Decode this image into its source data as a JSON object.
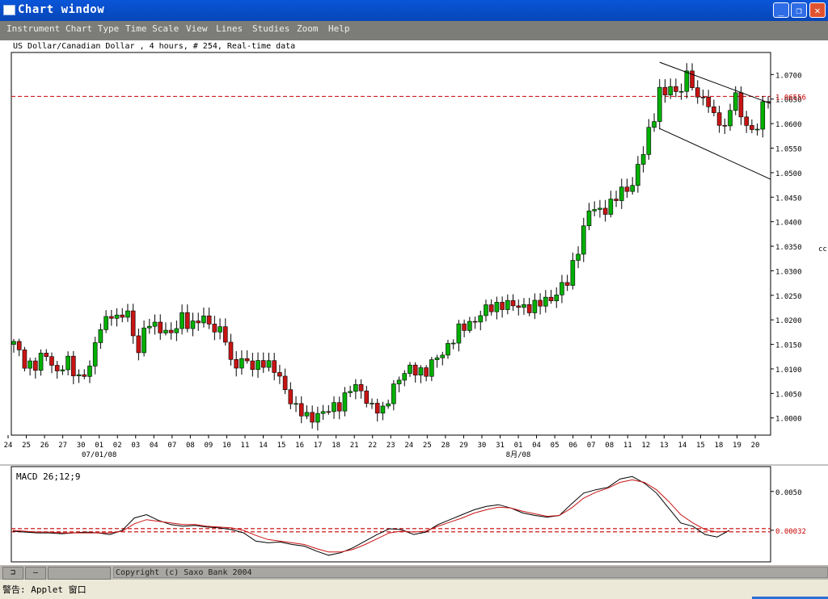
{
  "window": {
    "title": "Chart window",
    "icon": "app-window-icon",
    "btn_min": "_",
    "btn_max": "❐",
    "btn_close": "✕"
  },
  "menu": [
    "Instrument",
    "Chart Type",
    "Time Scale",
    "View",
    "Lines",
    "Studies",
    "Zoom",
    "Help"
  ],
  "chart_title": "US Dollar/Canadian Dollar , 4 hours, # 254, Real-time data",
  "side_label": "cc",
  "chart_data": [
    {
      "type": "candlestick",
      "y_ticks": [
        "1.0700",
        "1.0650",
        "1.0600",
        "1.0550",
        "1.0500",
        "1.0450",
        "1.0400",
        "1.0350",
        "1.0300",
        "1.0250",
        "1.0200",
        "1.0150",
        "1.0100",
        "1.0050",
        "1.0000"
      ],
      "ylim": [
        0.9965,
        1.0745
      ],
      "current_price_label": "1.06556",
      "current_price": 1.06556,
      "x_ticks": [
        "24",
        "25",
        "26",
        "27",
        "30",
        "01",
        "02",
        "03",
        "04",
        "07",
        "08",
        "09",
        "10",
        "11",
        "14",
        "15",
        "16",
        "17",
        "18",
        "21",
        "22",
        "23",
        "24",
        "25",
        "28",
        "29",
        "30",
        "31",
        "01",
        "04",
        "05",
        "06",
        "07",
        "08",
        "11",
        "12",
        "13",
        "14",
        "15",
        "18",
        "19",
        "20"
      ],
      "x_month_labels": [
        {
          "text": "07/01/08",
          "at_tick": 5
        },
        {
          "text": "8月/08",
          "at_tick": 28
        }
      ],
      "close_path": [
        [
          0,
          1.015
        ],
        [
          2,
          1.0115
        ],
        [
          4,
          1.0105
        ],
        [
          6,
          1.013
        ],
        [
          8,
          1.0095
        ],
        [
          10,
          1.011
        ],
        [
          12,
          1.0085
        ],
        [
          14,
          1.01
        ],
        [
          16,
          1.019
        ],
        [
          18,
          1.0215
        ],
        [
          19,
          1.0195
        ],
        [
          21,
          1.022
        ],
        [
          22,
          1.017
        ],
        [
          23,
          1.014
        ],
        [
          25,
          1.0195
        ],
        [
          27,
          1.0185
        ],
        [
          29,
          1.0165
        ],
        [
          31,
          1.021
        ],
        [
          33,
          1.0185
        ],
        [
          35,
          1.0205
        ],
        [
          37,
          1.0185
        ],
        [
          39,
          1.016
        ],
        [
          40,
          1.011
        ],
        [
          42,
          1.012
        ],
        [
          44,
          1.01
        ],
        [
          46,
          1.012
        ],
        [
          48,
          1.0095
        ],
        [
          50,
          1.006
        ],
        [
          52,
          1.002
        ],
        [
          54,
          0.9998
        ],
        [
          56,
          1.001
        ],
        [
          58,
          1.0012
        ],
        [
          60,
          1.003
        ],
        [
          62,
          1.006
        ],
        [
          64,
          1.0055
        ],
        [
          66,
          1.0025
        ],
        [
          68,
          1.0008
        ],
        [
          70,
          1.007
        ],
        [
          72,
          1.009
        ],
        [
          74,
          1.01
        ],
        [
          76,
          1.0095
        ],
        [
          78,
          1.012
        ],
        [
          80,
          1.015
        ],
        [
          82,
          1.0175
        ],
        [
          84,
          1.0195
        ],
        [
          86,
          1.021
        ],
        [
          88,
          1.0225
        ],
        [
          90,
          1.0235
        ],
        [
          92,
          1.0225
        ],
        [
          94,
          1.023
        ],
        [
          96,
          1.0225
        ],
        [
          98,
          1.024
        ],
        [
          100,
          1.0255
        ],
        [
          102,
          1.0275
        ],
        [
          104,
          1.035
        ],
        [
          106,
          1.042
        ],
        [
          108,
          1.0425
        ],
        [
          110,
          1.0435
        ],
        [
          112,
          1.046
        ],
        [
          114,
          1.048
        ],
        [
          116,
          1.054
        ],
        [
          118,
          1.062
        ],
        [
          119,
          1.067
        ],
        [
          120,
          1.066
        ],
        [
          121,
          1.067
        ],
        [
          122,
          1.066
        ],
        [
          123,
          1.068
        ],
        [
          124,
          1.07
        ],
        [
          125,
          1.068
        ],
        [
          126,
          1.064
        ],
        [
          127,
          1.066
        ],
        [
          128,
          1.064
        ],
        [
          129,
          1.062
        ],
        [
          130,
          1.06
        ],
        [
          131,
          1.058
        ],
        [
          132,
          1.064
        ],
        [
          133,
          1.066
        ],
        [
          134,
          1.062
        ],
        [
          135,
          1.059
        ],
        [
          136,
          1.058
        ],
        [
          137,
          1.06
        ],
        [
          138,
          1.064
        ],
        [
          139,
          1.0655
        ]
      ],
      "channel_upper": [
        [
          1.0725,
          119
        ],
        [
          1.0652,
          139
        ]
      ],
      "channel_lower": [
        [
          1.059,
          119
        ],
        [
          1.05,
          139
        ]
      ]
    },
    {
      "type": "line",
      "title": "MACD 26;12;9",
      "y_ticks": [
        "0.0050",
        "0.00032"
      ],
      "signal_level": 0.00032,
      "ylim": [
        -0.0035,
        0.008
      ],
      "series": [
        {
          "values": [
            0.0002,
            0.0001,
            0.0,
            0.0,
            -0.0001,
            0.0,
            0.0001,
            0.0,
            -0.0002,
            0.0003,
            0.0018,
            0.0022,
            0.0015,
            0.001,
            0.0008,
            0.0009,
            0.0007,
            0.0006,
            0.0004,
            0.0,
            -0.001,
            -0.0012,
            -0.0011,
            -0.0014,
            -0.0016,
            -0.0022,
            -0.0027,
            -0.0024,
            -0.0018,
            -0.001,
            -0.0002,
            0.0005,
            0.0004,
            -0.0002,
            0.0001,
            0.001,
            0.0016,
            0.0022,
            0.0028,
            0.0032,
            0.0034,
            0.003,
            0.0024,
            0.0021,
            0.0019,
            0.0021,
            0.0035,
            0.0048,
            0.0052,
            0.0055,
            0.0065,
            0.0068,
            0.006,
            0.0048,
            0.003,
            0.0012,
            0.0008,
            -0.0002,
            -0.0005,
            0.0003
          ]
        },
        {
          "values": [
            0.0003,
            0.0002,
            0.0001,
            0.0001,
            0.0,
            0.0,
            0.0,
            0.0,
            0.0,
            0.0002,
            0.0011,
            0.0016,
            0.0014,
            0.0012,
            0.001,
            0.001,
            0.0008,
            0.0007,
            0.0006,
            0.0003,
            -0.0003,
            -0.0008,
            -0.001,
            -0.0012,
            -0.0014,
            -0.0019,
            -0.0023,
            -0.0023,
            -0.002,
            -0.0014,
            -0.0007,
            0.0,
            0.0002,
            0.0001,
            0.0002,
            0.0008,
            0.0013,
            0.0018,
            0.0024,
            0.0028,
            0.0031,
            0.003,
            0.0026,
            0.0023,
            0.002,
            0.0021,
            0.003,
            0.0042,
            0.0049,
            0.0054,
            0.0061,
            0.0064,
            0.0061,
            0.0052,
            0.0038,
            0.0022,
            0.0012,
            0.0004,
            0.0001,
            0.0002
          ]
        }
      ]
    }
  ],
  "statusbar": {
    "copyright": "Copyright (c) Saxo Bank 2004",
    "btn1": "⊐",
    "btn2": "—"
  },
  "warning": "警告: Applet 窗口",
  "colors": {
    "up": "#00b000",
    "down": "#c81414",
    "grid_line": "#c80000",
    "title_blue": "#0a55d8"
  }
}
